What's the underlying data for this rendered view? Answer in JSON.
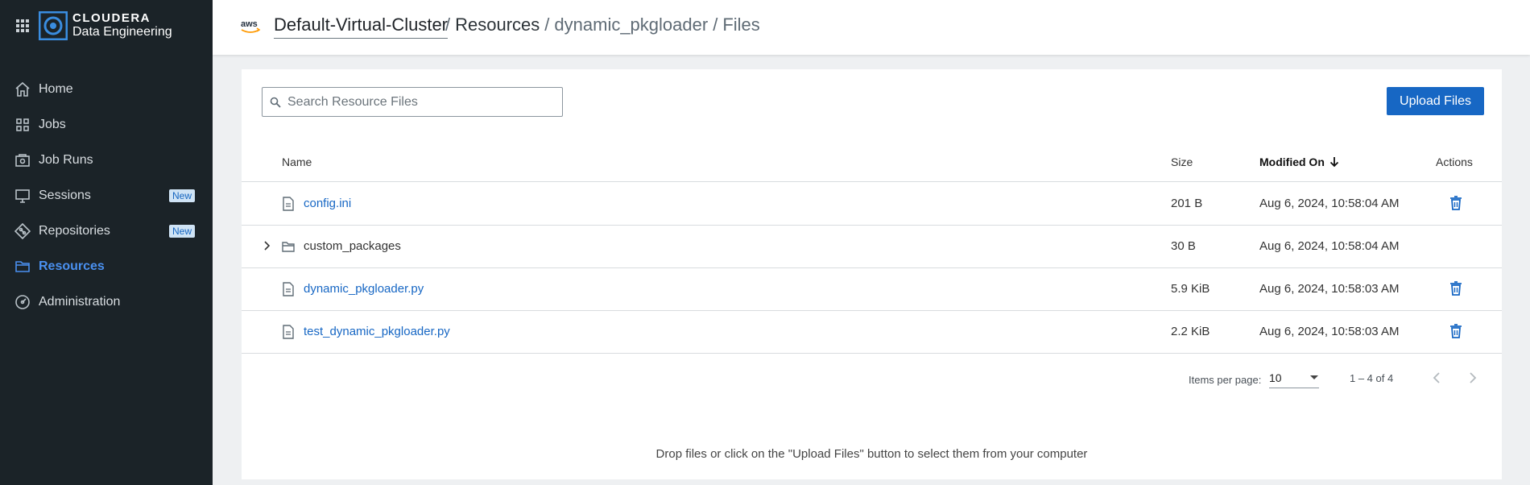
{
  "brand": {
    "top": "CLOUDERA",
    "bottom": "Data Engineering"
  },
  "sidebar": {
    "items": [
      {
        "label": "Home",
        "icon": "home-icon"
      },
      {
        "label": "Jobs",
        "icon": "jobs-icon"
      },
      {
        "label": "Job Runs",
        "icon": "job-runs-icon"
      },
      {
        "label": "Sessions",
        "icon": "sessions-icon",
        "badge": "New"
      },
      {
        "label": "Repositories",
        "icon": "repositories-icon",
        "badge": "New"
      },
      {
        "label": "Resources",
        "icon": "resources-icon",
        "active": true
      },
      {
        "label": "Administration",
        "icon": "administration-icon"
      }
    ]
  },
  "header": {
    "cloud": "aws",
    "cluster": "Default-Virtual-Cluster",
    "crumbs": [
      "Resources",
      "dynamic_pkgloader",
      "Files"
    ],
    "separator": "/"
  },
  "search": {
    "placeholder": "Search Resource Files"
  },
  "toolbar": {
    "upload_label": "Upload Files"
  },
  "table": {
    "columns": {
      "name": "Name",
      "size": "Size",
      "modified": "Modified On",
      "actions": "Actions"
    },
    "rows": [
      {
        "name": "config.ini",
        "type": "file",
        "size": "201 B",
        "modified": "Aug 6, 2024, 10:58:04 AM",
        "deletable": true
      },
      {
        "name": "custom_packages",
        "type": "folder",
        "size": "30 B",
        "modified": "Aug 6, 2024, 10:58:04 AM",
        "deletable": false
      },
      {
        "name": "dynamic_pkgloader.py",
        "type": "file",
        "size": "5.9 KiB",
        "modified": "Aug 6, 2024, 10:58:03 AM",
        "deletable": true
      },
      {
        "name": "test_dynamic_pkgloader.py",
        "type": "file",
        "size": "2.2 KiB",
        "modified": "Aug 6, 2024, 10:58:03 AM",
        "deletable": true
      }
    ]
  },
  "pager": {
    "items_per_page_label": "Items per page:",
    "items_per_page": "10",
    "range": "1 – 4 of 4"
  },
  "drop_hint": "Drop files or click on the \"Upload Files\" button to select them from your computer",
  "colors": {
    "accent": "#1767c4",
    "sidebar_bg": "#1b2328",
    "active_nav": "#4a90f0",
    "badge_bg": "#cfe3f5"
  }
}
